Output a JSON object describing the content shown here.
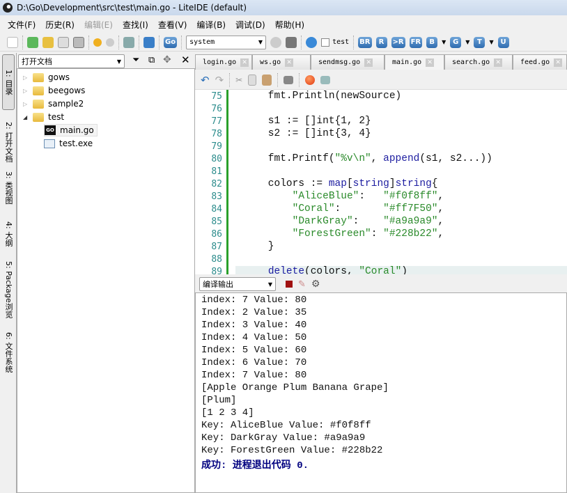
{
  "window": {
    "title": "D:\\Go\\Development\\src\\test\\main.go - LiteIDE (default)"
  },
  "menu": [
    {
      "label": "文件(F)"
    },
    {
      "label": "历史(R)"
    },
    {
      "label": "编辑(E)",
      "disabled": true
    },
    {
      "label": "查找(I)"
    },
    {
      "label": "查看(V)"
    },
    {
      "label": "编译(B)"
    },
    {
      "label": "调试(D)"
    },
    {
      "label": "帮助(H)"
    }
  ],
  "toolbar": {
    "env_select": "system",
    "build_config_checkbox": "test",
    "build_buttons": [
      "BR",
      "R",
      ">R",
      "FR",
      "B",
      "G",
      "T",
      "U"
    ]
  },
  "side_tabs": [
    "1: 目录",
    "2: 打开文档",
    "3: 类视图",
    "4: 大纲",
    "5: Package浏览",
    "6: 文件系统"
  ],
  "left_panel": {
    "combo": "打开文档",
    "tree": [
      {
        "label": "gows",
        "type": "folder",
        "expanded": false
      },
      {
        "label": "beegows",
        "type": "folder",
        "expanded": false
      },
      {
        "label": "sample2",
        "type": "folder",
        "expanded": false
      },
      {
        "label": "test",
        "type": "folder",
        "expanded": true
      },
      {
        "label": "main.go",
        "type": "go",
        "selected": true
      },
      {
        "label": "test.exe",
        "type": "exe"
      }
    ]
  },
  "editor_tabs": [
    {
      "label": "login.go"
    },
    {
      "label": "ws.go"
    },
    {
      "label": "sendmsg.go"
    },
    {
      "label": "main.go"
    },
    {
      "label": "search.go"
    },
    {
      "label": "feed.go"
    }
  ],
  "code": {
    "line_numbers": [
      "75",
      "76",
      "77",
      "78",
      "79",
      "80",
      "81",
      "82",
      "83",
      "84",
      "85",
      "86",
      "87",
      "88",
      "89"
    ],
    "lines": [
      "    fmt.Println(newSource)",
      "",
      "    s1 := []int{1, 2}",
      "    s2 := []int{3, 4}",
      "",
      "    fmt.Printf(\"%v\\n\", append(s1, s2...))",
      "",
      "    colors := map[string]string{",
      "        \"AliceBlue\":   \"#f0f8ff\",",
      "        \"Coral\":       \"#ff7F50\",",
      "        \"DarkGray\":    \"#a9a9a9\",",
      "        \"ForestGreen\": \"#228b22\",",
      "    }",
      "",
      "    delete(colors, \"Coral\")"
    ]
  },
  "output": {
    "combo": "编译输出",
    "lines": [
      "index: 7 Value: 80",
      "Index: 2 Value: 35",
      "Index: 3 Value: 40",
      "Index: 4 Value: 50",
      "Index: 5 Value: 60",
      "Index: 6 Value: 70",
      "Index: 7 Value: 80",
      "[Apple Orange Plum Banana Grape]",
      "[Plum]",
      "[1 2 3 4]",
      "Key: AliceBlue Value: #f0f8ff",
      "Key: DarkGray Value: #a9a9a9",
      "Key: ForestGreen Value: #228b22"
    ],
    "status": "成功: 进程退出代码 0."
  },
  "colors": {
    "gutter_bar": "#2aa02a",
    "line_numbers": "#2c8c8c",
    "keyword": "#1c1ca0",
    "number": "#901090",
    "string": "#2a8a2a",
    "success": "#000080"
  }
}
